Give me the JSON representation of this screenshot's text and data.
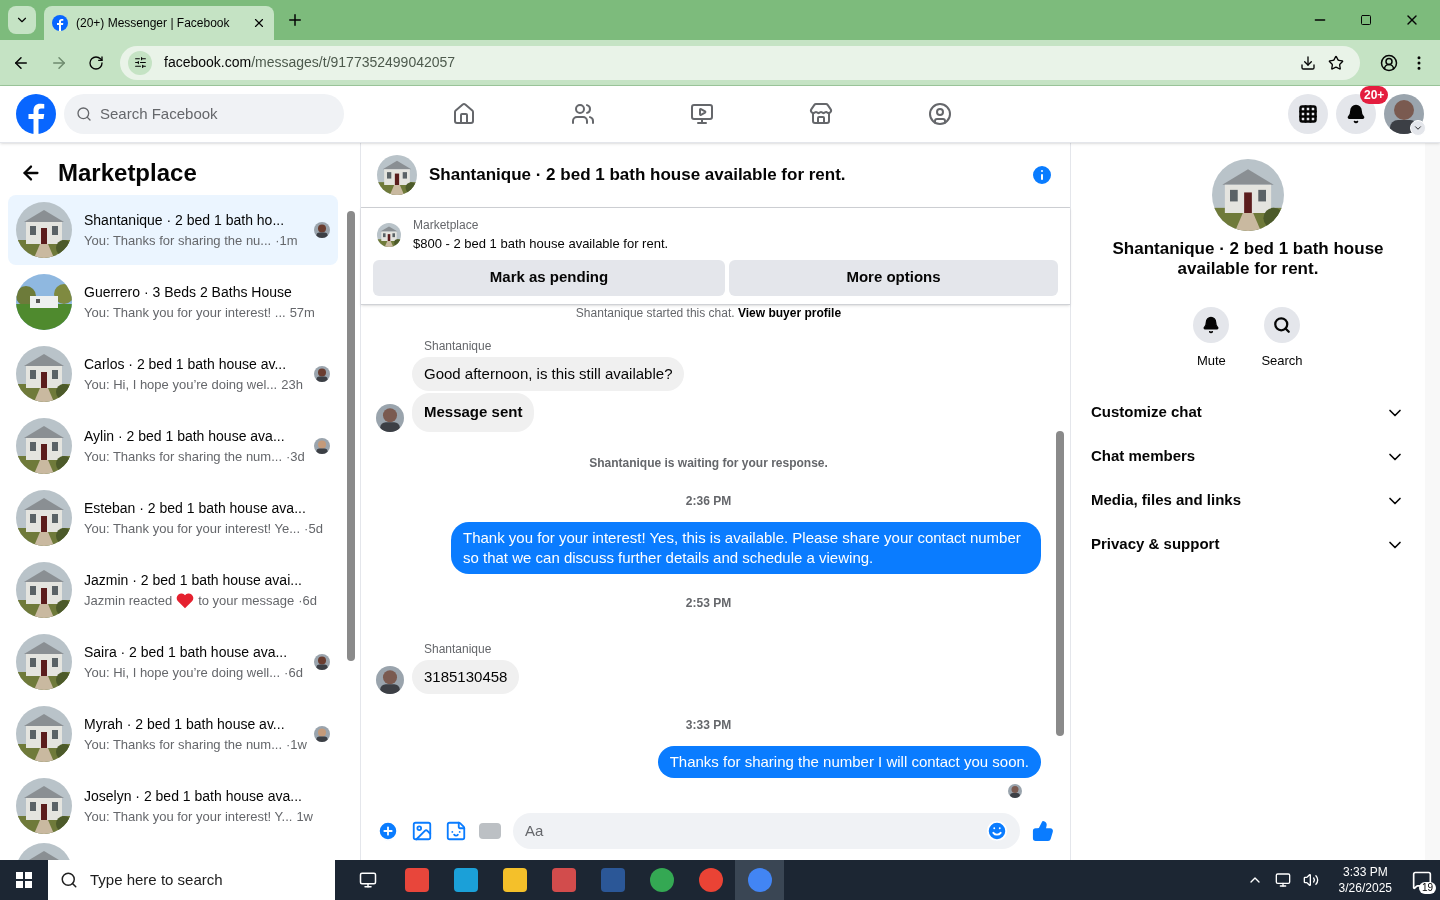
{
  "browser": {
    "tab_title": "(20+) Messenger | Facebook",
    "url_host": "facebook.com",
    "url_path": "/messages/t/9177352499042057"
  },
  "topbar": {
    "search_placeholder": "Search Facebook",
    "notifications_badge": "20+",
    "nav": [
      {
        "selected": false
      },
      {
        "selected": false
      },
      {
        "selected": false
      },
      {
        "selected": false
      },
      {
        "selected": false
      }
    ]
  },
  "sidebar": {
    "title": "Marketplace",
    "conversations": [
      {
        "name": "Shantanique · 2 bed 1 bath ho...",
        "preview": "You: Thanks for sharing the nu...",
        "time": "·1m",
        "selected": true,
        "seen": true,
        "kind": "text"
      },
      {
        "name": "Guerrero · 3 Beds 2 Baths House",
        "preview": "You: Thank you for your interest! ...",
        "time": "57m",
        "selected": false,
        "seen": false,
        "kind": "text"
      },
      {
        "name": "Carlos · 2 bed 1 bath house av...",
        "preview": "You: Hi, I hope you’re doing wel...",
        "time": "23h",
        "selected": false,
        "seen": true,
        "kind": "text"
      },
      {
        "name": "Aylin · 2 bed 1 bath house ava...",
        "preview": "You: Thanks for sharing the num...",
        "time": "·3d",
        "selected": false,
        "seen": true,
        "kind": "text"
      },
      {
        "name": "Esteban · 2 bed 1 bath house ava...",
        "preview": "You: Thank you for your interest! Ye...",
        "time": "·5d",
        "selected": false,
        "seen": false,
        "kind": "text"
      },
      {
        "name": "Jazmin · 2 bed 1 bath house avai...",
        "preview": "Jazmin reacted",
        "preview_after": "to your message",
        "time": "·6d",
        "selected": false,
        "seen": false,
        "kind": "reaction"
      },
      {
        "name": "Saira · 2 bed 1 bath house ava...",
        "preview": "You: Hi, I hope you’re doing well...",
        "time": "·6d",
        "selected": false,
        "seen": true,
        "kind": "text"
      },
      {
        "name": "Myrah · 2 bed 1 bath house av...",
        "preview": "You: Thanks for sharing the num...",
        "time": "·1w",
        "selected": false,
        "seen": true,
        "kind": "text"
      },
      {
        "name": "Joselyn · 2 bed 1 bath house ava...",
        "preview": "You: Thank you for your interest! Y...",
        "time": "1w",
        "selected": false,
        "seen": false,
        "kind": "text"
      }
    ]
  },
  "chat": {
    "title": "Shantanique · 2 bed 1 bath house available for rent.",
    "listing_label": "Marketplace",
    "listing_text": "$800 - 2 bed 1 bath house available for rent.",
    "actions": [
      "Mark as pending",
      "More options"
    ],
    "messages": [
      {
        "kind": "notice",
        "text": "Shantanique started this chat.",
        "link": "View buyer profile"
      },
      {
        "kind": "sender",
        "text": "Shantanique"
      },
      {
        "kind": "incoming",
        "text": "Good afternoon, is this still available?",
        "avatar": false,
        "emphasis": false
      },
      {
        "kind": "incoming",
        "text": "Message sent",
        "avatar": true,
        "emphasis": true
      },
      {
        "kind": "status",
        "text": "Shantanique is waiting for your response."
      },
      {
        "kind": "time",
        "text": "2:36 PM"
      },
      {
        "kind": "outgoing",
        "text": "Thank you for your interest! Yes, this is available. Please share your contact number so that we can discuss further details and schedule a viewing."
      },
      {
        "kind": "time",
        "text": "2:53 PM"
      },
      {
        "kind": "sender",
        "text": "Shantanique"
      },
      {
        "kind": "incoming",
        "text": "3185130458",
        "avatar": true,
        "emphasis": false
      },
      {
        "kind": "time",
        "text": "3:33 PM"
      },
      {
        "kind": "outgoing",
        "text": "Thanks for sharing the number I will contact you soon."
      },
      {
        "kind": "seen"
      }
    ],
    "composer_placeholder": "Aa"
  },
  "details": {
    "title": "Shantanique · 2 bed 1 bath house available for rent.",
    "actions": [
      {
        "label": "Mute"
      },
      {
        "label": "Search"
      }
    ],
    "sections": [
      {
        "label": "Customize chat",
        "expanded": false
      },
      {
        "label": "Chat members",
        "expanded": false
      },
      {
        "label": "Media, files and links",
        "expanded": false
      },
      {
        "label": "Privacy & support",
        "expanded": false
      }
    ]
  },
  "taskbar": {
    "search_placeholder": "Type here to search",
    "time": "3:33 PM",
    "date": "3/26/2025",
    "notification_count": "19"
  }
}
